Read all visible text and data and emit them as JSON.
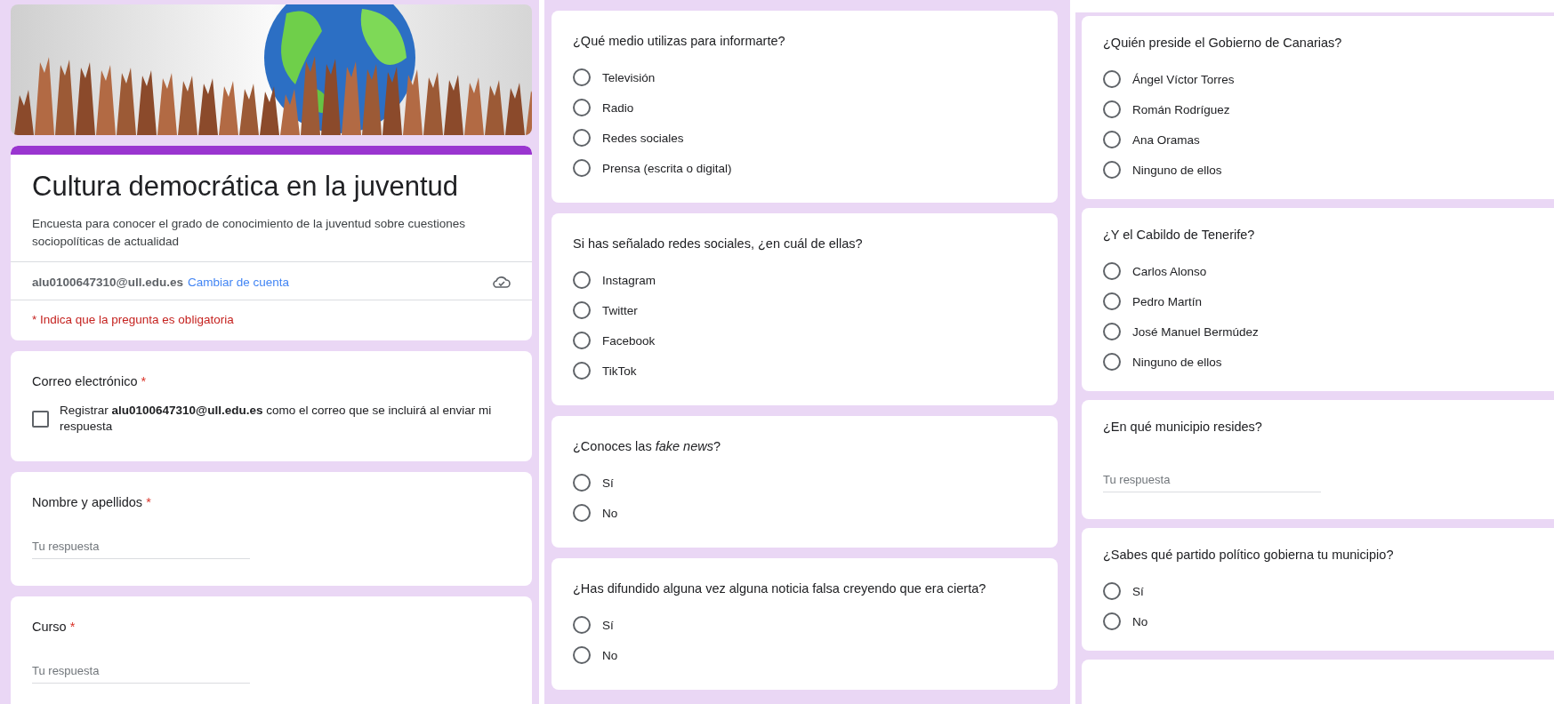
{
  "columns": [
    {
      "banner": {
        "kind": "picture"
      },
      "cards": [
        {
          "kind": "header",
          "title": "Cultura democrática en la juventud",
          "description": "Encuesta para conocer el grado de conocimiento de la juventud sobre cuestiones sociopolíticas de actualidad",
          "account": "alu0100647310@ull.edu.es",
          "switch_link": "Cambiar de cuenta",
          "required_note": "* Indica que la pregunta es obligatoria"
        },
        {
          "kind": "checkbox",
          "question": "Correo electrónico",
          "required_mark": "*",
          "option": {
            "label": "Registrar **alu0100647310@ull.edu.es** como el correo que se incluirá al enviar mi respuesta",
            "checked": false
          }
        },
        {
          "kind": "text",
          "question": "Nombre y apellidos",
          "required_mark": "*",
          "placeholder": "Tu respuesta"
        },
        {
          "kind": "text",
          "question": "Curso",
          "required_mark": "*",
          "placeholder": "Tu respuesta"
        }
      ]
    },
    {
      "cards": [
        {
          "kind": "radio",
          "question": "¿Qué medio utilizas para informarte?",
          "options": [
            {
              "label": "Televisión",
              "selected": false
            },
            {
              "label": "Radio",
              "selected": false
            },
            {
              "label": "Redes sociales",
              "selected": false
            },
            {
              "label": "Prensa (escrita o digital)",
              "selected": false
            }
          ]
        },
        {
          "kind": "radio",
          "question": "Si has señalado redes sociales, ¿en cuál de ellas?",
          "options": [
            {
              "label": "Instagram",
              "selected": false
            },
            {
              "label": "Twitter",
              "selected": false
            },
            {
              "label": "Facebook",
              "selected": false
            },
            {
              "label": "TikTok",
              "selected": false
            }
          ]
        },
        {
          "kind": "radio",
          "question": "¿Conoces las *fake news*?",
          "options": [
            {
              "label": "Sí",
              "selected": false
            },
            {
              "label": "No",
              "selected": false
            }
          ]
        },
        {
          "kind": "radio",
          "question": "¿Has difundido alguna vez alguna noticia falsa creyendo que era cierta?",
          "options": [
            {
              "label": "Sí",
              "selected": false
            },
            {
              "label": "No",
              "selected": false
            }
          ]
        }
      ]
    },
    {
      "cards": [
        {
          "kind": "radio",
          "question": "¿Quién preside el Gobierno de Canarias?",
          "options": [
            {
              "label": "Ángel Víctor Torres",
              "selected": false
            },
            {
              "label": "Román Rodríguez",
              "selected": false
            },
            {
              "label": "Ana Oramas",
              "selected": false
            },
            {
              "label": "Ninguno de ellos",
              "selected": false
            }
          ]
        },
        {
          "kind": "radio",
          "question": "¿Y el Cabildo de Tenerife?",
          "options": [
            {
              "label": "Carlos Alonso",
              "selected": false
            },
            {
              "label": "Pedro Martín",
              "selected": false
            },
            {
              "label": "José Manuel Bermúdez",
              "selected": false
            },
            {
              "label": "Ninguno de ellos",
              "selected": false
            }
          ]
        },
        {
          "kind": "text",
          "question": "¿En qué municipio resides?",
          "placeholder": "Tu respuesta"
        },
        {
          "kind": "radio",
          "question": "¿Sabes qué partido político gobierna tu municipio?",
          "options": [
            {
              "label": "Sí",
              "selected": false
            },
            {
              "label": "No",
              "selected": false
            }
          ]
        },
        {
          "kind": "empty"
        }
      ]
    }
  ]
}
